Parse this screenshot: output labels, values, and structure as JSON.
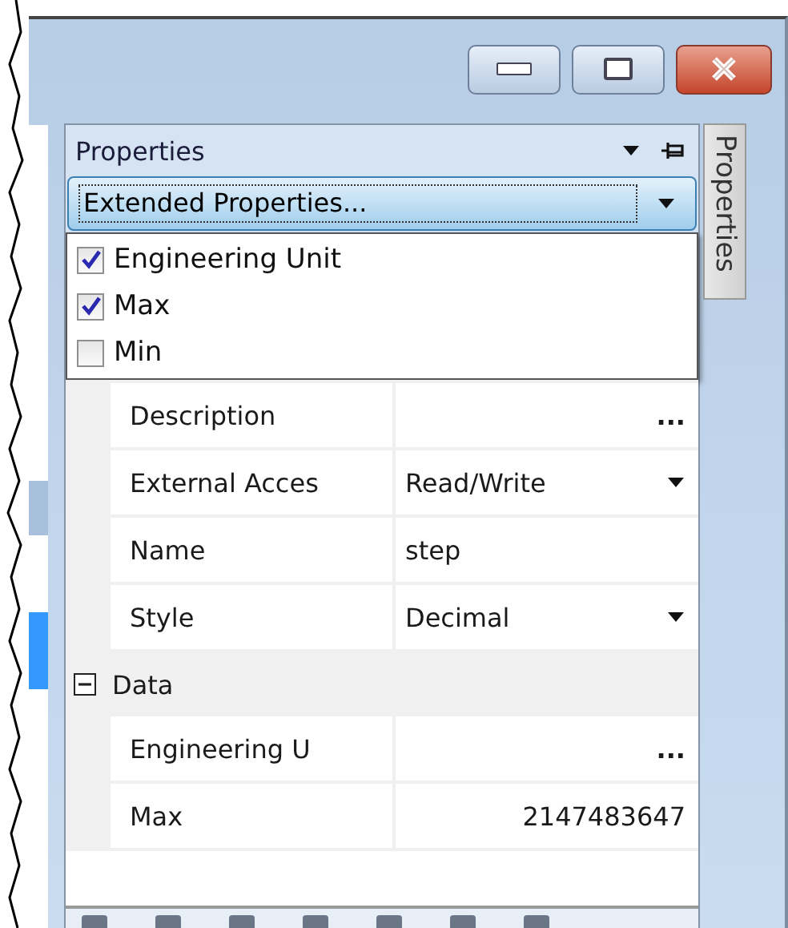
{
  "window": {
    "buttons": [
      {
        "kind": "minimize"
      },
      {
        "kind": "maximize"
      },
      {
        "kind": "close"
      }
    ]
  },
  "properties_pane": {
    "title": "Properties",
    "selector": {
      "value": "Extended Properties..."
    },
    "extended_list": [
      {
        "label": "Engineering Unit",
        "checked": true
      },
      {
        "label": "Max",
        "checked": true
      },
      {
        "label": "Min",
        "checked": false
      }
    ],
    "grid": [
      {
        "kind": "ellipsis",
        "name": "Description",
        "button": "..."
      },
      {
        "kind": "dropdown",
        "name": "External Acces",
        "value": "Read/Write"
      },
      {
        "kind": "text",
        "name": "Name",
        "value": "step"
      },
      {
        "kind": "dropdown",
        "name": "Style",
        "value": "Decimal"
      },
      {
        "kind": "category",
        "name": "Data",
        "expanded": true,
        "children": [
          {
            "kind": "ellipsis",
            "name": "Engineering U",
            "button": "..."
          },
          {
            "kind": "number",
            "name": "Max",
            "value": "2147483647"
          }
        ]
      }
    ]
  },
  "side_tab": {
    "label": "Properties"
  }
}
